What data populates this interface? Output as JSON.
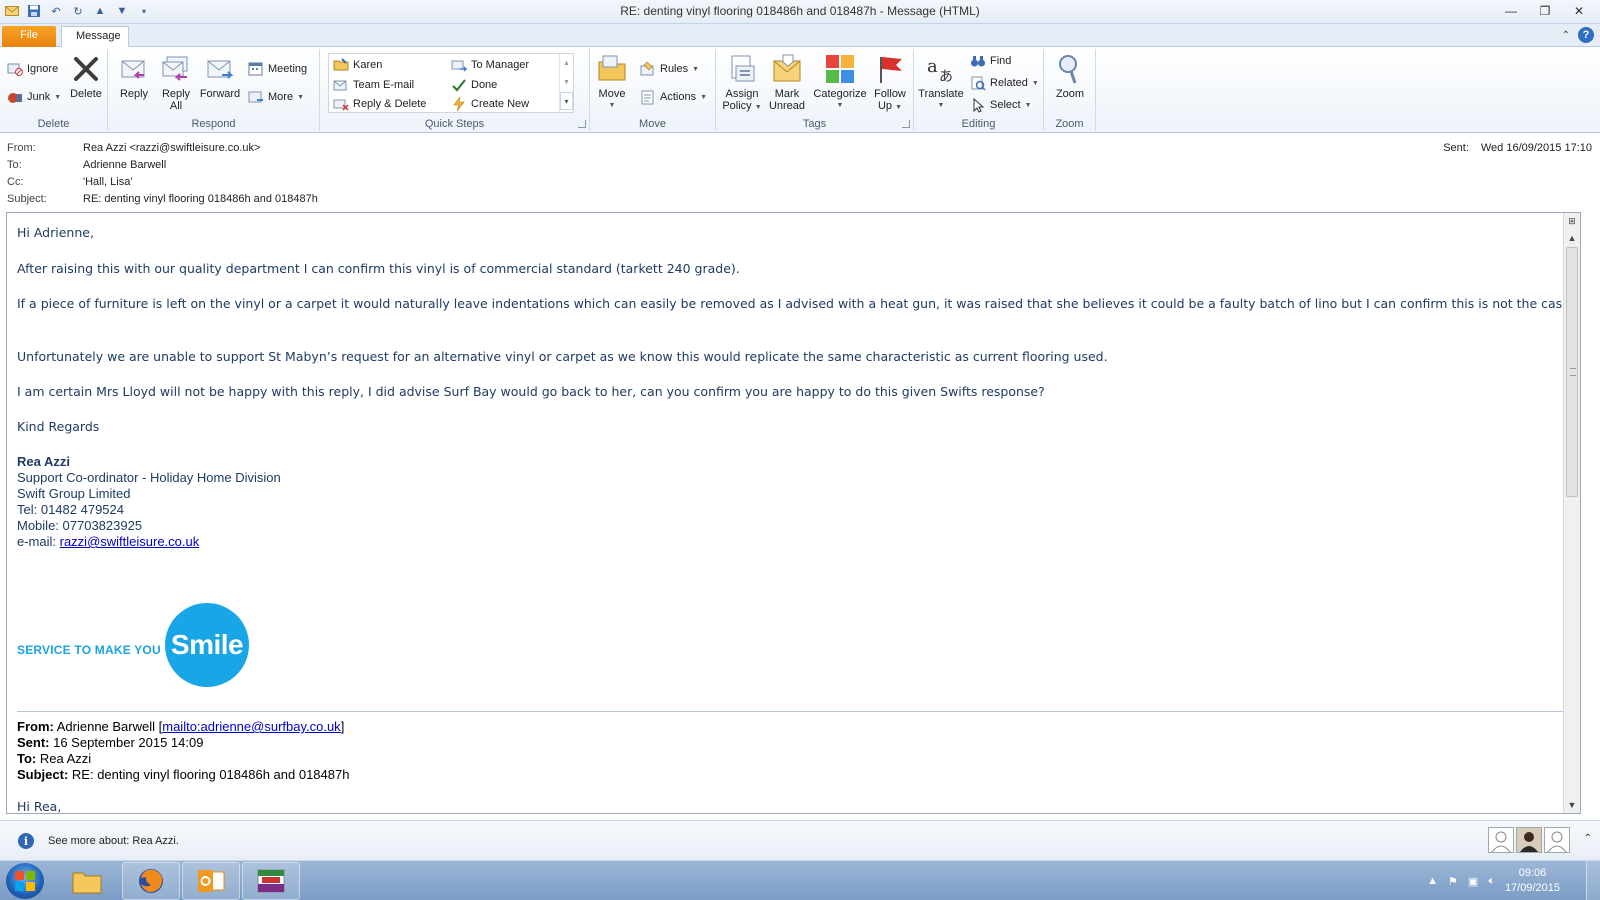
{
  "window": {
    "title": "RE: denting vinyl flooring 018486h and 018487h  -  Message (HTML)",
    "minimize": "—",
    "maximize": "❐",
    "close": "✕"
  },
  "tabs": {
    "file": "File",
    "message": "Message"
  },
  "ribbon": {
    "delete_group": {
      "label": "Delete",
      "ignore": "Ignore",
      "junk": "Junk",
      "delete": "Delete"
    },
    "respond_group": {
      "label": "Respond",
      "reply": "Reply",
      "reply_all_1": "Reply",
      "reply_all_2": "All",
      "forward": "Forward",
      "meeting": "Meeting",
      "more": "More"
    },
    "quicksteps_group": {
      "label": "Quick Steps",
      "items": [
        "Karen",
        "To Manager",
        "Team E-mail",
        "Done",
        "Reply & Delete",
        "Create New"
      ]
    },
    "move_group": {
      "label": "Move",
      "move": "Move",
      "rules": "Rules",
      "actions": "Actions"
    },
    "tags_group": {
      "label": "Tags",
      "assign_1": "Assign",
      "assign_2": "Policy",
      "mark_1": "Mark",
      "mark_2": "Unread",
      "categorize": "Categorize",
      "follow_1": "Follow",
      "follow_2": "Up"
    },
    "editing_group": {
      "label": "Editing",
      "translate": "Translate",
      "find": "Find",
      "related": "Related",
      "select": "Select"
    },
    "zoom_group": {
      "label": "Zoom",
      "zoom": "Zoom"
    }
  },
  "header": {
    "from_label": "From:",
    "from_value": "Rea Azzi <razzi@swiftleisure.co.uk>",
    "to_label": "To:",
    "to_value": "Adrienne Barwell",
    "cc_label": "Cc:",
    "cc_value": "'Hall, Lisa'",
    "subject_label": "Subject:",
    "subject_value": "RE: denting vinyl flooring 018486h and 018487h",
    "sent_label": "Sent:",
    "sent_value": "Wed 16/09/2015 17:10"
  },
  "body": {
    "greeting": "Hi Adrienne,",
    "p1": "After raising this with our quality department I can confirm this vinyl is of commercial standard (tarkett 240 grade).",
    "p2": "If a piece of furniture is left on the vinyl or a carpet it would naturally leave indentations which can easily be removed as I advised with a heat gun, it was raised that she believes it could be a faulty batch of lino but I can confirm this is not the case.",
    "p3": "Unfortunately we are unable to support St Mabyn’s request for an alternative vinyl or carpet as we know this would replicate the same characteristic as current flooring used.",
    "p4": "I am certain Mrs Lloyd will not  be happy with this reply, I did advise Surf Bay would go back to her, can you confirm you are happy to do this given Swifts response?",
    "closing": "Kind Regards",
    "signature": {
      "name": "Rea Azzi",
      "title": "Support Co-ordinator - Holiday Home Division",
      "company": "Swift Group Limited",
      "tel": "Tel: 01482 479524",
      "mobile": "Mobile: 07703823925",
      "email_label": "e-mail: ",
      "email": "razzi@swiftleisure.co.uk"
    },
    "logo": {
      "text": "SERVICE TO MAKE YOU",
      "circle": "Smile"
    },
    "original": {
      "from_label": "From:",
      "from_value": " Adrienne Barwell [",
      "from_link": "mailto:adrienne@surfbay.co.uk",
      "from_end": "]",
      "sent_label": "Sent:",
      "sent_value": " 16 September 2015 14:09",
      "to_label": "To:",
      "to_value": " Rea Azzi",
      "subject_label": "Subject:",
      "subject_value": " RE: denting vinyl flooring 018486h and 018487h",
      "greeting": "Hi Rea,"
    }
  },
  "people_pane": {
    "text": "See more about: Rea Azzi."
  },
  "taskbar": {
    "time": "09:06",
    "date": "17/09/2015"
  }
}
